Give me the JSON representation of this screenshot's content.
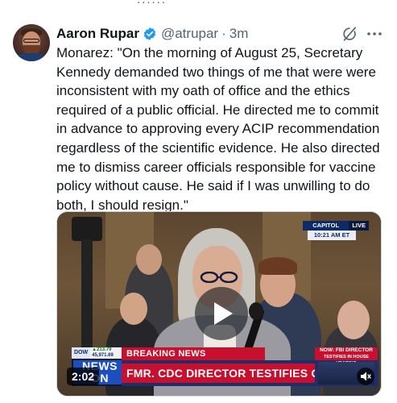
{
  "top_fade_text": "......",
  "tweet": {
    "author_name": "Aaron Rupar",
    "handle": "@atrupar",
    "separator": "·",
    "time": "3m",
    "text": "Monarez: \"On the morning of August 25, Secretary Kennedy demanded two things of me that were were inconsistent with my oath of office and the ethics required of a public official. He directed me to commit in advance to approving every ACIP recommendation regardless of the scientific evidence. He also directed me to dismiss career officials responsible for vaccine policy without cause. He said if I was unwilling to do both, I should resign.\""
  },
  "video": {
    "duration": "2:02",
    "capitol_badge": {
      "location": "CAPITOL HILL",
      "live": "LIVE",
      "time": "10:21 AM ET"
    },
    "ticker": {
      "index": "DOW",
      "change": "▲213.79",
      "value": "45,971.69",
      "logo": "NEWS ON"
    },
    "breaking_label": "BREAKING NEWS",
    "headline": "FMR. CDC DIRECTOR TESTIFIES ON FIRING",
    "now_label_line1": "NOW: FBI DIRECTOR",
    "now_label_line2": "TESTIFIES IN HOUSE HEARING"
  },
  "colors": {
    "verified_blue": "#1d9bf0",
    "secondary_text": "#536471",
    "breaking_red": "#c8102e",
    "news_navy": "#1c2f6b"
  },
  "icons": [
    "verified-badge-icon",
    "grok-icon",
    "more-icon",
    "play-icon",
    "mute-icon"
  ]
}
